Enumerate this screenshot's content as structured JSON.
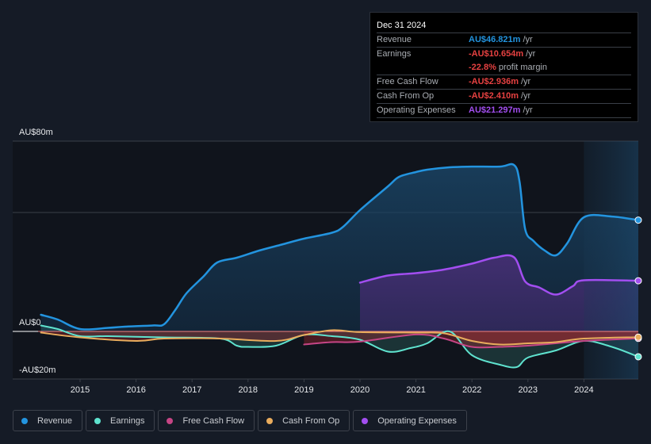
{
  "tooltip": {
    "date": "Dec 31 2024",
    "rows": [
      {
        "label": "Revenue",
        "value": "AU$46.821m",
        "unit": "/yr",
        "color": "#2394df"
      },
      {
        "label": "Earnings",
        "value": "-AU$10.654m",
        "unit": "/yr",
        "color": "#e64141"
      },
      {
        "label": "",
        "value": "-22.8%",
        "unit": "profit margin",
        "color": "#e64141"
      },
      {
        "label": "Free Cash Flow",
        "value": "-AU$2.936m",
        "unit": "/yr",
        "color": "#e64141"
      },
      {
        "label": "Cash From Op",
        "value": "-AU$2.410m",
        "unit": "/yr",
        "color": "#e64141"
      },
      {
        "label": "Operating Expenses",
        "value": "AU$21.297m",
        "unit": "/yr",
        "color": "#a24ef0"
      }
    ]
  },
  "legend": [
    {
      "label": "Revenue",
      "color": "#2394df"
    },
    {
      "label": "Earnings",
      "color": "#5fe3cf"
    },
    {
      "label": "Free Cash Flow",
      "color": "#c64585"
    },
    {
      "label": "Cash From Op",
      "color": "#e9ac5d"
    },
    {
      "label": "Operating Expenses",
      "color": "#a24ef0"
    }
  ],
  "chart_data": {
    "type": "line",
    "title": "",
    "xlabel": "",
    "ylabel": "",
    "ylim": [
      -20,
      80
    ],
    "xlim": [
      2014.3,
      2025.0
    ],
    "y_tick_labels": [
      "AU$80m",
      "AU$0",
      "-AU$20m"
    ],
    "y_ticks": [
      80,
      0,
      -20
    ],
    "gridlines_y": [
      80,
      50,
      0
    ],
    "x_tick_labels": [
      "2015",
      "2016",
      "2017",
      "2018",
      "2019",
      "2020",
      "2021",
      "2022",
      "2023",
      "2024"
    ],
    "x_ticks": [
      2015,
      2016,
      2017,
      2018,
      2019,
      2020,
      2021,
      2022,
      2023,
      2024
    ],
    "highlight_range": [
      2024.0,
      2025.0
    ],
    "legend_position": "bottom",
    "series": [
      {
        "name": "Revenue",
        "color": "#2394df",
        "fill": true,
        "points": [
          [
            2014.3,
            7
          ],
          [
            2014.6,
            5
          ],
          [
            2015.0,
            1
          ],
          [
            2015.5,
            1.5
          ],
          [
            2015.8,
            2
          ],
          [
            2016.3,
            2.5
          ],
          [
            2016.5,
            3
          ],
          [
            2016.7,
            9
          ],
          [
            2016.9,
            16
          ],
          [
            2017.2,
            23
          ],
          [
            2017.45,
            29
          ],
          [
            2017.8,
            31
          ],
          [
            2018.2,
            34
          ],
          [
            2018.6,
            36.5
          ],
          [
            2019.0,
            39
          ],
          [
            2019.5,
            41.5
          ],
          [
            2019.7,
            44
          ],
          [
            2020.0,
            51
          ],
          [
            2020.5,
            61
          ],
          [
            2020.7,
            65
          ],
          [
            2021.0,
            67
          ],
          [
            2021.2,
            68
          ],
          [
            2021.6,
            69
          ],
          [
            2022.0,
            69.3
          ],
          [
            2022.5,
            69.3
          ],
          [
            2022.75,
            70
          ],
          [
            2022.85,
            63
          ],
          [
            2022.95,
            43
          ],
          [
            2023.1,
            38
          ],
          [
            2023.3,
            34
          ],
          [
            2023.5,
            32
          ],
          [
            2023.7,
            37
          ],
          [
            2024.0,
            48
          ],
          [
            2024.5,
            48.3
          ],
          [
            2025.0,
            46.8
          ]
        ]
      },
      {
        "name": "Operating Expenses",
        "color": "#a24ef0",
        "fill": true,
        "points": [
          [
            2020.0,
            20.5
          ],
          [
            2020.5,
            23.5
          ],
          [
            2021.0,
            24.5
          ],
          [
            2021.5,
            26
          ],
          [
            2022.0,
            28.5
          ],
          [
            2022.4,
            31
          ],
          [
            2022.75,
            31.2
          ],
          [
            2022.95,
            21
          ],
          [
            2023.2,
            18.5
          ],
          [
            2023.5,
            15.5
          ],
          [
            2023.8,
            19
          ],
          [
            2024.0,
            21.5
          ],
          [
            2025.0,
            21.3
          ]
        ]
      },
      {
        "name": "Earnings",
        "color": "#5fe3cf",
        "fill": true,
        "points": [
          [
            2014.3,
            2.5
          ],
          [
            2014.6,
            1
          ],
          [
            2015.0,
            -2
          ],
          [
            2015.5,
            -2
          ],
          [
            2016.5,
            -2.5
          ],
          [
            2017.5,
            -3
          ],
          [
            2017.8,
            -6
          ],
          [
            2018.0,
            -6.5
          ],
          [
            2018.5,
            -6
          ],
          [
            2019.0,
            -1.5
          ],
          [
            2019.5,
            -2
          ],
          [
            2020.0,
            -3.5
          ],
          [
            2020.5,
            -8.5
          ],
          [
            2020.9,
            -7
          ],
          [
            2021.2,
            -5
          ],
          [
            2021.6,
            0
          ],
          [
            2022.0,
            -10
          ],
          [
            2022.5,
            -14
          ],
          [
            2022.8,
            -15
          ],
          [
            2023.0,
            -11
          ],
          [
            2023.5,
            -8
          ],
          [
            2024.0,
            -4
          ],
          [
            2024.5,
            -6.5
          ],
          [
            2025.0,
            -10.654
          ]
        ]
      },
      {
        "name": "Free Cash Flow",
        "color": "#c64585",
        "fill": false,
        "points": [
          [
            2019.0,
            -5.5
          ],
          [
            2019.5,
            -4.5
          ],
          [
            2020.0,
            -4.3
          ],
          [
            2021.0,
            -1.3
          ],
          [
            2021.5,
            -3
          ],
          [
            2022.0,
            -6.5
          ],
          [
            2022.5,
            -6.5
          ],
          [
            2023.0,
            -6
          ],
          [
            2024.0,
            -4
          ],
          [
            2025.0,
            -2.936
          ]
        ]
      },
      {
        "name": "Cash From Op",
        "color": "#e9ac5d",
        "fill": false,
        "points": [
          [
            2014.3,
            -0.5
          ],
          [
            2015.0,
            -2.5
          ],
          [
            2016.0,
            -4
          ],
          [
            2016.5,
            -3
          ],
          [
            2017.5,
            -3
          ],
          [
            2018.5,
            -4
          ],
          [
            2019.0,
            -1.5
          ],
          [
            2019.5,
            0.5
          ],
          [
            2020.0,
            -0.3
          ],
          [
            2021.0,
            -0.5
          ],
          [
            2021.5,
            -0.8
          ],
          [
            2022.0,
            -4
          ],
          [
            2022.5,
            -5.5
          ],
          [
            2023.0,
            -5
          ],
          [
            2023.5,
            -4.5
          ],
          [
            2024.0,
            -3
          ],
          [
            2025.0,
            -2.41
          ]
        ]
      }
    ]
  }
}
